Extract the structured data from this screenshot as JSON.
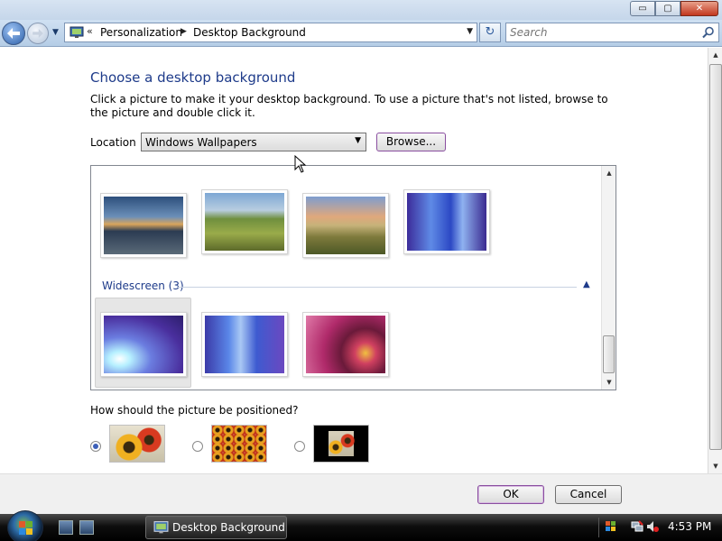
{
  "window": {
    "buttons": {
      "minimize": "▭",
      "maximize": "▢",
      "close": "✕"
    }
  },
  "nav": {
    "chevron": "«",
    "breadcrumb": [
      "Personalization",
      "Desktop Background"
    ],
    "crumb_sep": "▶",
    "search_placeholder": "Search",
    "refresh": "↻"
  },
  "page": {
    "title": "Choose a desktop background",
    "description": "Click a picture to make it your desktop background. To use a picture that's not listed, browse to the picture and double click it.",
    "location_label": "Location",
    "location_value": "Windows Wallpapers",
    "browse_label": "Browse...",
    "group_header": "Widescreen (3)",
    "position_question": "How should the picture be positioned?",
    "position_options": [
      {
        "name": "Fit to screen",
        "selected": true
      },
      {
        "name": "Tile",
        "selected": false
      },
      {
        "name": "Center",
        "selected": false
      }
    ]
  },
  "wallpapers": {
    "row1": [
      "coastline-dusk",
      "grassy-cliff",
      "lake-sunset",
      "blue-aurora"
    ],
    "widescreen": [
      "purple-rays",
      "blue-streaks",
      "pink-vista-logo"
    ],
    "selected": "purple-rays"
  },
  "footer": {
    "ok_label": "OK",
    "cancel_label": "Cancel"
  },
  "taskbar": {
    "task_label": "Desktop Background",
    "clock": "4:53 PM"
  },
  "colors": {
    "title_blue": "#1e3b8a",
    "accent_purple": "#8a4fa0",
    "chrome_blue": "#c5d6ea"
  }
}
